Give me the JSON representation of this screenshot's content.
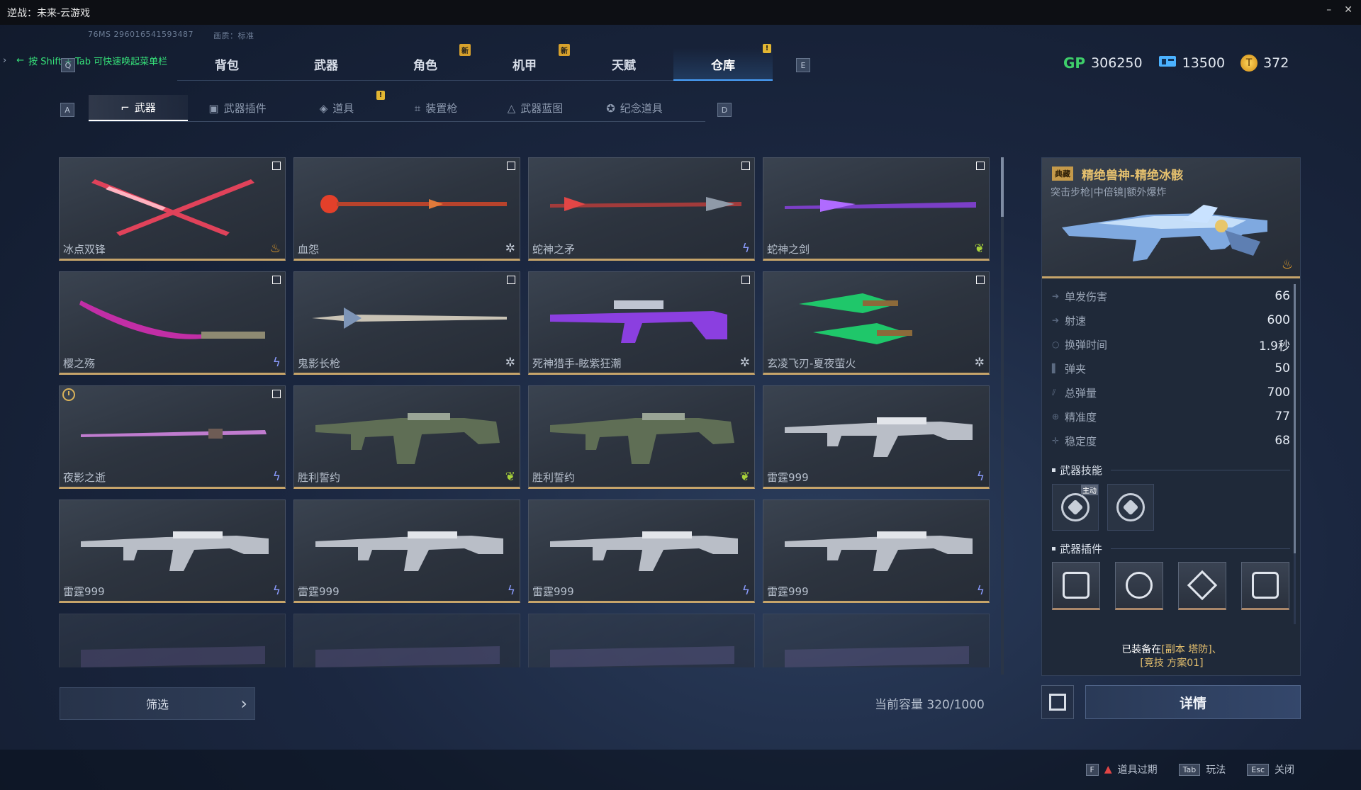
{
  "window": {
    "title": "逆战：未来-云游戏",
    "controls": [
      "–",
      "✕"
    ]
  },
  "meta": {
    "latency": "76MS",
    "session_id": "296016541593487",
    "quality": "画质：标准"
  },
  "hint": {
    "text": "按 Shift + Tab 可快速唤起菜单栏"
  },
  "top_tabs": [
    {
      "label": "背包",
      "badge": ""
    },
    {
      "label": "武器",
      "badge": ""
    },
    {
      "label": "角色",
      "badge": "新"
    },
    {
      "label": "机甲",
      "badge": "新"
    },
    {
      "label": "天赋",
      "badge": ""
    },
    {
      "label": "仓库",
      "badge": "!",
      "active": true
    }
  ],
  "keys": {
    "prev_top": "Q",
    "next_top": "E",
    "prev_sub": "A",
    "next_sub": "D"
  },
  "currencies": {
    "gp_icon": "GP",
    "gp": "306250",
    "voucher": "13500",
    "coin": "372"
  },
  "sub_tabs": [
    {
      "label": "武器",
      "icon": "rifle-icon",
      "active": true
    },
    {
      "label": "武器插件",
      "icon": "plugin-icon"
    },
    {
      "label": "道具",
      "icon": "item-icon",
      "badge": "!"
    },
    {
      "label": "装置枪",
      "icon": "device-gun-icon"
    },
    {
      "label": "武器蓝图",
      "icon": "blueprint-icon"
    },
    {
      "label": "纪念道具",
      "icon": "memento-icon"
    }
  ],
  "items": [
    {
      "name": "冰点双锋",
      "rarity": "fire",
      "checkbox": true
    },
    {
      "name": "血怨",
      "rarity": "snow",
      "checkbox": true
    },
    {
      "name": "蛇神之矛",
      "rarity": "bolt",
      "checkbox": true
    },
    {
      "name": "蛇神之剑",
      "rarity": "leaf",
      "checkbox": true
    },
    {
      "name": "樱之殇",
      "rarity": "bolt",
      "checkbox": true
    },
    {
      "name": "鬼影长枪",
      "rarity": "snow",
      "checkbox": true
    },
    {
      "name": "死神猎手-眩紫狂潮",
      "rarity": "snow",
      "checkbox": true
    },
    {
      "name": "玄凌飞刃-夏夜萤火",
      "rarity": "snow",
      "checkbox": true
    },
    {
      "name": "夜影之逝",
      "rarity": "bolt",
      "checkbox": true,
      "timed": true
    },
    {
      "name": "胜利誓约",
      "rarity": "leaf"
    },
    {
      "name": "胜利誓约",
      "rarity": "leaf"
    },
    {
      "name": "雷霆999",
      "rarity": "bolt"
    },
    {
      "name": "雷霆999",
      "rarity": "bolt"
    },
    {
      "name": "雷霆999",
      "rarity": "bolt"
    },
    {
      "name": "雷霆999",
      "rarity": "bolt"
    },
    {
      "name": "雷霆999",
      "rarity": "bolt"
    },
    {
      "name": "",
      "rarity": "",
      "partial": true
    },
    {
      "name": "",
      "rarity": "",
      "partial": true
    },
    {
      "name": "",
      "rarity": "",
      "partial": true
    },
    {
      "name": "",
      "rarity": "",
      "partial": true
    }
  ],
  "filter": {
    "label": "筛选"
  },
  "capacity": {
    "label": "当前容量 320/1000"
  },
  "detail": {
    "quality_tag": "典藏",
    "title": "精绝兽神-精绝冰骸",
    "subtitle": "突击步枪|中倍镜|额外爆炸",
    "stats": [
      {
        "label": "单发伤害",
        "value": "66"
      },
      {
        "label": "射速",
        "value": "600"
      },
      {
        "label": "换弹时间",
        "value": "1.9秒"
      },
      {
        "label": "弹夹",
        "value": "50"
      },
      {
        "label": "总弹量",
        "value": "700"
      },
      {
        "label": "精准度",
        "value": "77"
      },
      {
        "label": "稳定度",
        "value": "68"
      }
    ],
    "skills_title": "武器技能",
    "skill_main_tag": "主动",
    "plugins_title": "武器插件",
    "equipped_prefix": "已装备在",
    "equipped_line1": "[副本 塔防]、",
    "equipped_line2": "[竞技 方案01]",
    "detail_button": "详情"
  },
  "bottom_actions": [
    {
      "key": "F",
      "label": "道具过期",
      "warn": true
    },
    {
      "key": "Tab",
      "label": "玩法"
    },
    {
      "key": "Esc",
      "label": "关闭"
    }
  ],
  "colors": {
    "accent_blue": "#4aa3ff",
    "rarity_gold": "#c6a46a",
    "title_gold": "#e5c06e",
    "hint_green": "#36e27a"
  }
}
